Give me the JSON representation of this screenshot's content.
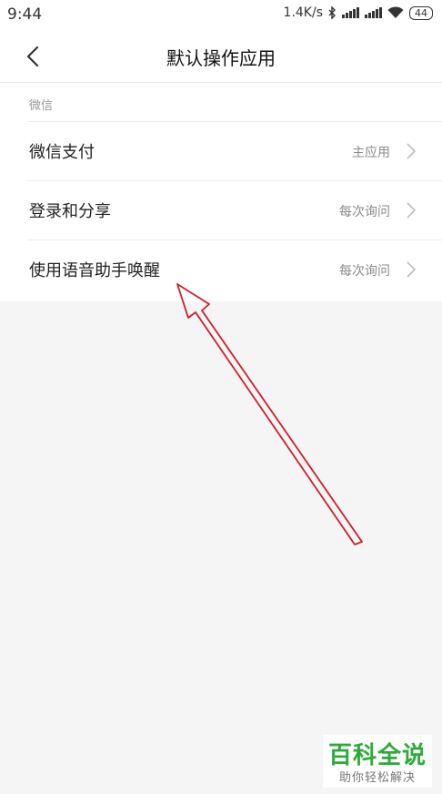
{
  "status_bar": {
    "time": "9:44",
    "network_speed": "1.4K/s",
    "battery": "44"
  },
  "header": {
    "title": "默认操作应用"
  },
  "section": {
    "label": "微信"
  },
  "rows": [
    {
      "title": "微信支付",
      "value": "主应用"
    },
    {
      "title": "登录和分享",
      "value": "每次询问"
    },
    {
      "title": "使用语音助手唤醒",
      "value": "每次询问"
    }
  ],
  "watermark": {
    "main": "百科全说",
    "sub": "助你轻松解决"
  },
  "colors": {
    "annotation_arrow": "#cc1f2a",
    "watermark_green": "#2eaa3a"
  }
}
